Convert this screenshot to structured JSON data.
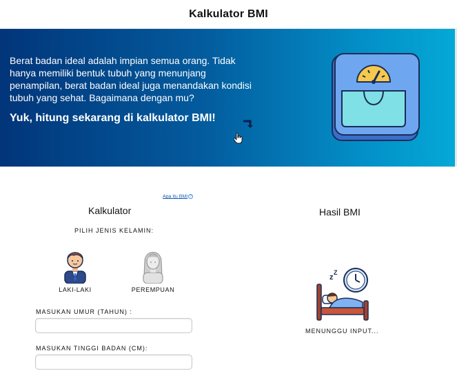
{
  "header": {
    "title": "Kalkulator BMI"
  },
  "hero": {
    "description": "Berat badan ideal adalah impian semua orang. Tidak hanya memiliki bentuk tubuh yang menunjang penampilan, berat badan ideal juga menandakan kondisi tubuh yang sehat. Bagaimana dengan mu?",
    "cta": "Yuk, hitung sekarang di kalkulator BMI!",
    "gradient_colors": [
      "#02357a",
      "#04a9d6"
    ]
  },
  "calculator": {
    "help_link": "Apa itu BMI",
    "title": "Kalkulator",
    "gender_prompt": "PILIH JENIS KELAMIN:",
    "male_label": "LAKI-LAKI",
    "female_label": "PEREMPUAN",
    "age_label": "MASUKAN UMUR (TAHUN) :",
    "age_value": "",
    "height_label": "MASUKAN TINGGI BADAN (CM):",
    "height_value": ""
  },
  "result": {
    "title": "Hasil BMI",
    "status": "MENUNGGU INPUT..."
  }
}
